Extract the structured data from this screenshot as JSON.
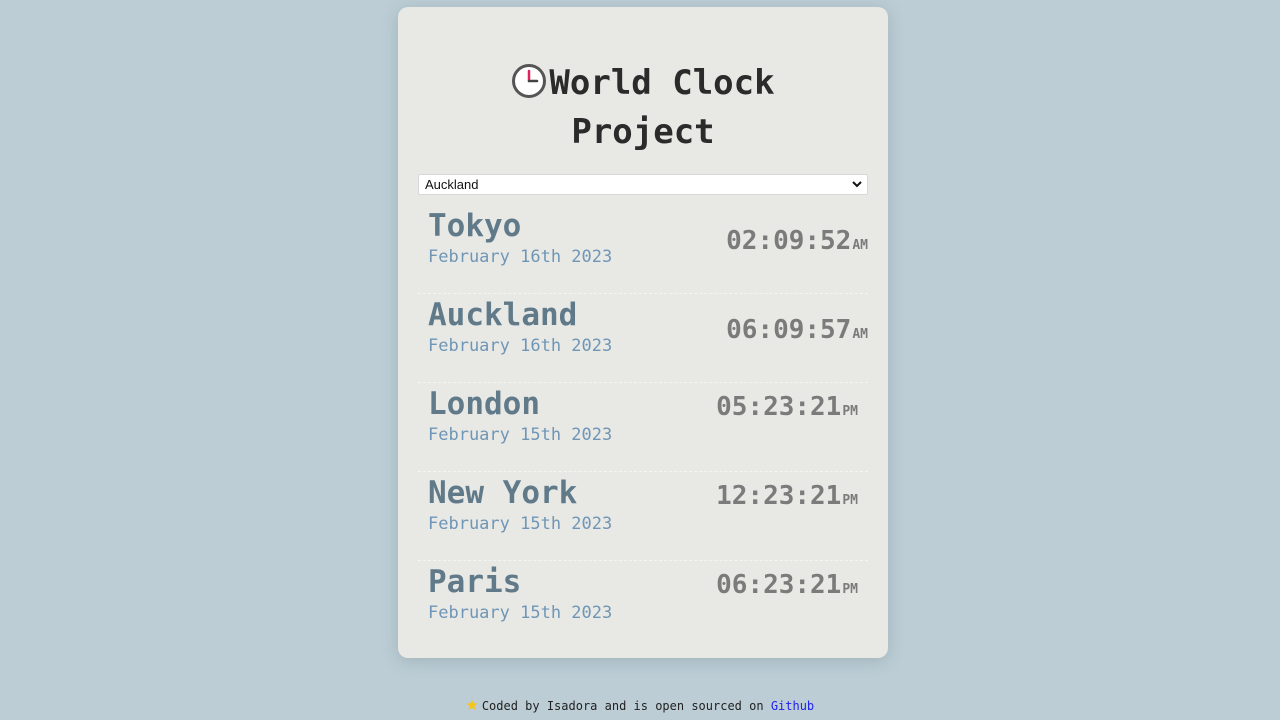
{
  "header": {
    "title_line1": "World Clock",
    "title_line2": "Project",
    "icon": "clock-icon"
  },
  "city_select": {
    "selected": "Auckland",
    "icon": "chevron-down-icon"
  },
  "cities": [
    {
      "name": "Tokyo",
      "date": "February 16th 2023",
      "time": "02:09:52",
      "ampm": "AM"
    },
    {
      "name": "Auckland",
      "date": "February 16th 2023",
      "time": "06:09:57",
      "ampm": "AM"
    },
    {
      "name": "London",
      "date": "February 15th 2023",
      "time": "05:23:21",
      "ampm": "PM"
    },
    {
      "name": "New York",
      "date": "February 15th 2023",
      "time": "12:23:21",
      "ampm": "PM"
    },
    {
      "name": "Paris",
      "date": "February 15th 2023",
      "time": "06:23:21",
      "ampm": "PM"
    }
  ],
  "footer": {
    "icon": "star-icon",
    "text": "Coded by Isadora and is open sourced on",
    "link_label": "Github"
  },
  "colors": {
    "background": "#bccdd5",
    "card": "#e8e8e4",
    "city_name": "#607a8a",
    "city_date": "#6f96b6",
    "time": "#7b7b7b",
    "link": "#2222ee"
  }
}
